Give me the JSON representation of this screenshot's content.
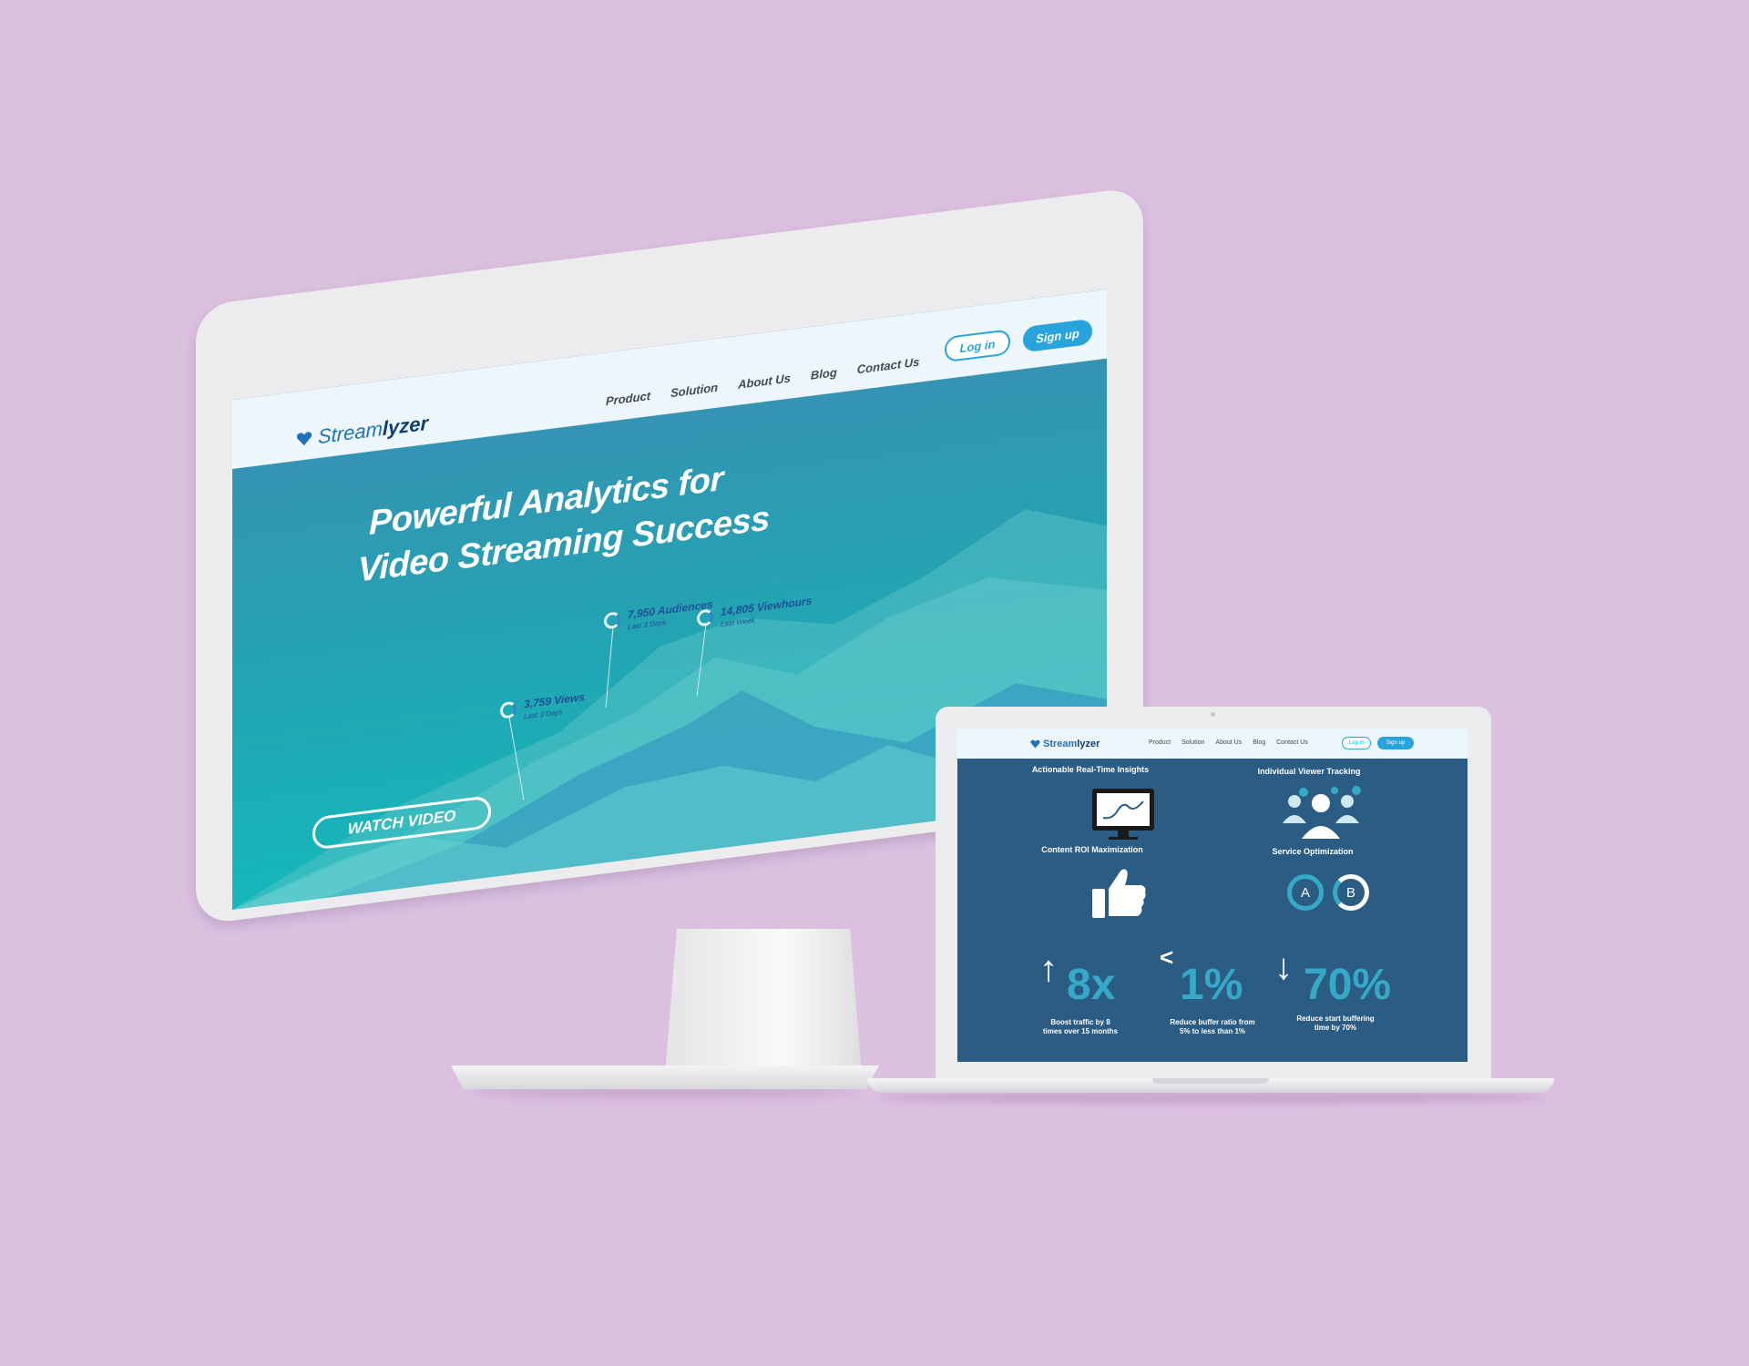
{
  "desktop": {
    "logo": {
      "part1": "Stream",
      "part2": "lyzer"
    },
    "nav": [
      {
        "label": "Product"
      },
      {
        "label": "Solution"
      },
      {
        "label": "About Us"
      },
      {
        "label": "Blog"
      },
      {
        "label": "Contact Us"
      }
    ],
    "login_label": "Log in",
    "signup_label": "Sign up",
    "hero": {
      "line1": "Powerful Analytics for",
      "line2": "Video Streaming Success"
    },
    "watch_video_label": "WATCH VIDEO",
    "stats": [
      {
        "value": "3,759 Views",
        "sub": "Last 3 Days"
      },
      {
        "value": "7,950  Audiences",
        "sub": "Last 3 Days"
      },
      {
        "value": "14,805 Viewhours",
        "sub": "Last Week"
      }
    ]
  },
  "laptop": {
    "logo": {
      "part1": "Stream",
      "part2": "lyzer"
    },
    "nav": [
      {
        "label": "Product"
      },
      {
        "label": "Solution"
      },
      {
        "label": "About Us"
      },
      {
        "label": "Blog"
      },
      {
        "label": "Contact Us"
      }
    ],
    "login_label": "Log in",
    "signup_label": "Sign up",
    "features": [
      {
        "title": "Actionable Real-Time Insights",
        "icon": "monitor-chart-icon"
      },
      {
        "title": "Individual Viewer Tracking",
        "icon": "users-icon"
      },
      {
        "title": "Content ROI Maximization",
        "icon": "thumbs-up-icon"
      },
      {
        "title": "Service Optimization",
        "icon": "ab-test-icon"
      }
    ],
    "ab": {
      "a": "A",
      "b": "B"
    },
    "stats": [
      {
        "arrow": "↑",
        "value": "8x",
        "caption1": "Boost traffic by 8",
        "caption2": "times over 15 months"
      },
      {
        "arrow": "<",
        "value": "1%",
        "caption1": "Reduce buffer ratio from",
        "caption2": "5% to less than 1%"
      },
      {
        "arrow": "↓",
        "value": "70%",
        "caption1": "Reduce start buffering",
        "caption2": "time by 70%"
      }
    ]
  },
  "colors": {
    "background": "#dcc0e0",
    "accent": "#29a3dc",
    "laptop_screen": "#2b5d84",
    "stat_number": "#36a8c8"
  }
}
